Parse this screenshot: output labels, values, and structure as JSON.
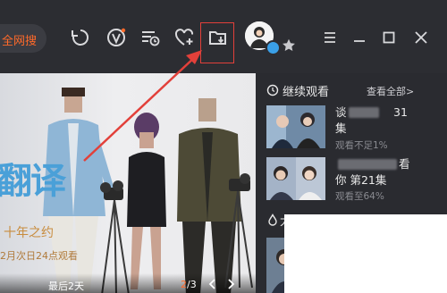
{
  "topbar": {
    "search_label": "全网搜",
    "icons": [
      "history-icon",
      "vip-icon",
      "playlist-icon",
      "favorite-icon",
      "download-folder-icon",
      "menu-icon",
      "minimize-icon",
      "maximize-icon",
      "close-icon"
    ]
  },
  "banner": {
    "title": "翻译",
    "tagline": "十年之约",
    "air_info": "2月次日24点观看",
    "caption": "最后2天",
    "page_current": "2",
    "page_total": "/3"
  },
  "continue_watching": {
    "title": "继续观看",
    "see_all": "查看全部>",
    "items": [
      {
        "title_a": "谈",
        "title_b": "31",
        "title_c": "集",
        "progress": "观看不足1%"
      },
      {
        "title_a": "",
        "title_b": "看",
        "title_c": "你  第21集",
        "progress": "观看至64%"
      }
    ]
  },
  "second_section": {
    "title": "大"
  },
  "colors": {
    "accent": "#ff6a2a",
    "annotation_red": "#e2403a",
    "panel_bg": "#2a2b30"
  }
}
